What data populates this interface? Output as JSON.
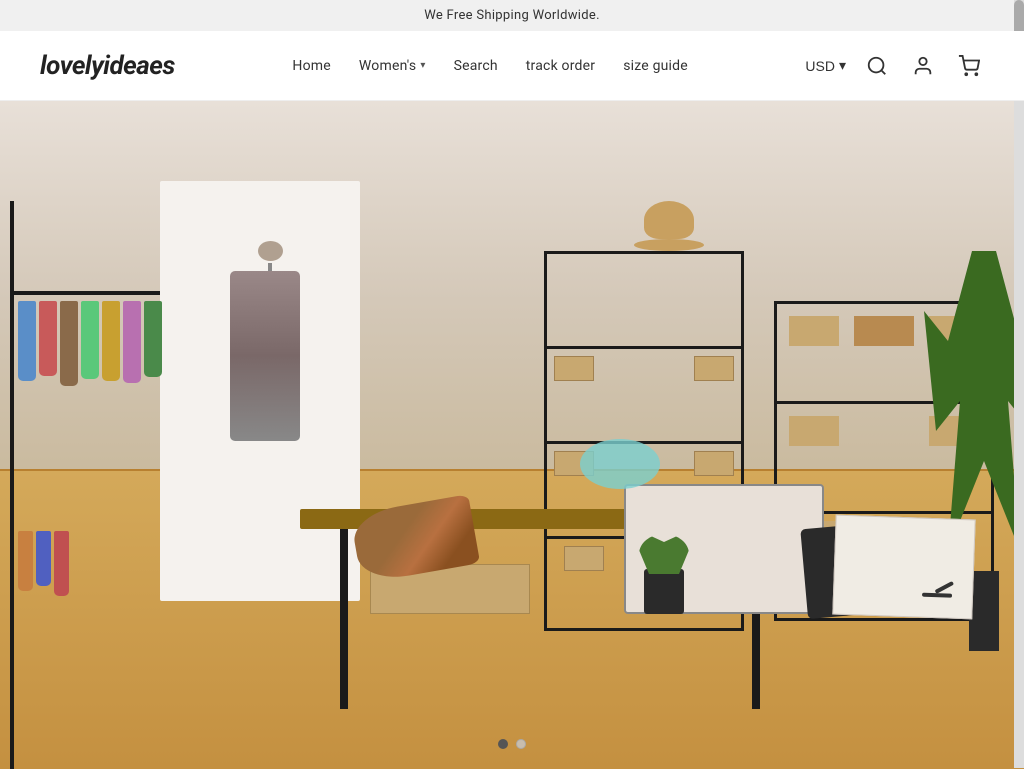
{
  "announcement": {
    "text": "We Free Shipping Worldwide."
  },
  "header": {
    "logo": "lovelyideaes",
    "nav": {
      "home": "Home",
      "womens": "Women's",
      "search": "Search",
      "track_order": "track order",
      "size_guide": "size guide",
      "currency": "USD"
    },
    "currency_arrow": "▾"
  },
  "hero": {
    "carousel": {
      "dots": [
        {
          "active": true
        },
        {
          "active": false
        }
      ]
    }
  },
  "icons": {
    "search": "🔍",
    "user": "👤",
    "cart": "🛒"
  }
}
